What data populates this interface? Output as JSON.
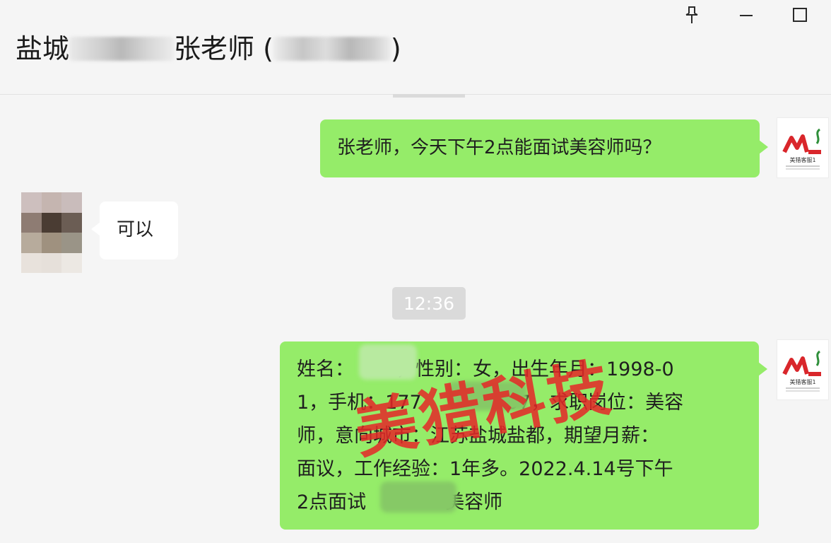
{
  "header": {
    "title_prefix": "盐城",
    "title_middle": "张老师 (",
    "title_suffix": ")"
  },
  "window_controls": {
    "pin": "pin-icon",
    "minimize": "minimize-icon",
    "maximize": "maximize-icon"
  },
  "self_avatar": {
    "logo_letters": "ML",
    "logo_caption": "美猎客服1"
  },
  "messages": [
    {
      "side": "right",
      "text": "张老师，今天下午2点能面试美容师吗？"
    },
    {
      "side": "left",
      "text": "可以"
    },
    {
      "type": "time",
      "text": "12:36"
    },
    {
      "side": "right",
      "text": "姓名：，性别：女，出生年月：1998-01，手机：17757，求职岗位：美容师，意向城市：江苏盐城盐都，期望月薪：面议，工作经验：1年多。2022.4.14号下午2点面试美容师",
      "lines": [
        {
          "parts": [
            "姓名：",
            "",
            "，性别：女，出生年月：1998-0"
          ]
        },
        {
          "parts": [
            "1，手机：177",
            "",
            "57，求职岗位：美容"
          ]
        },
        {
          "parts": [
            "师，意向城市：江苏盐城盐都，期望月薪："
          ]
        },
        {
          "parts": [
            "面议，工作经验：1年多。2022.4.14号下午"
          ]
        },
        {
          "parts": [
            "2点面试",
            "",
            "美容师"
          ]
        }
      ]
    }
  ],
  "watermark": "美猎科技",
  "colors": {
    "bubble_green": "#95ec69",
    "bubble_white": "#ffffff",
    "background": "#f5f5f5",
    "watermark_red": "#e42828",
    "logo_red": "#d9262b",
    "logo_green": "#2f8f3a"
  }
}
